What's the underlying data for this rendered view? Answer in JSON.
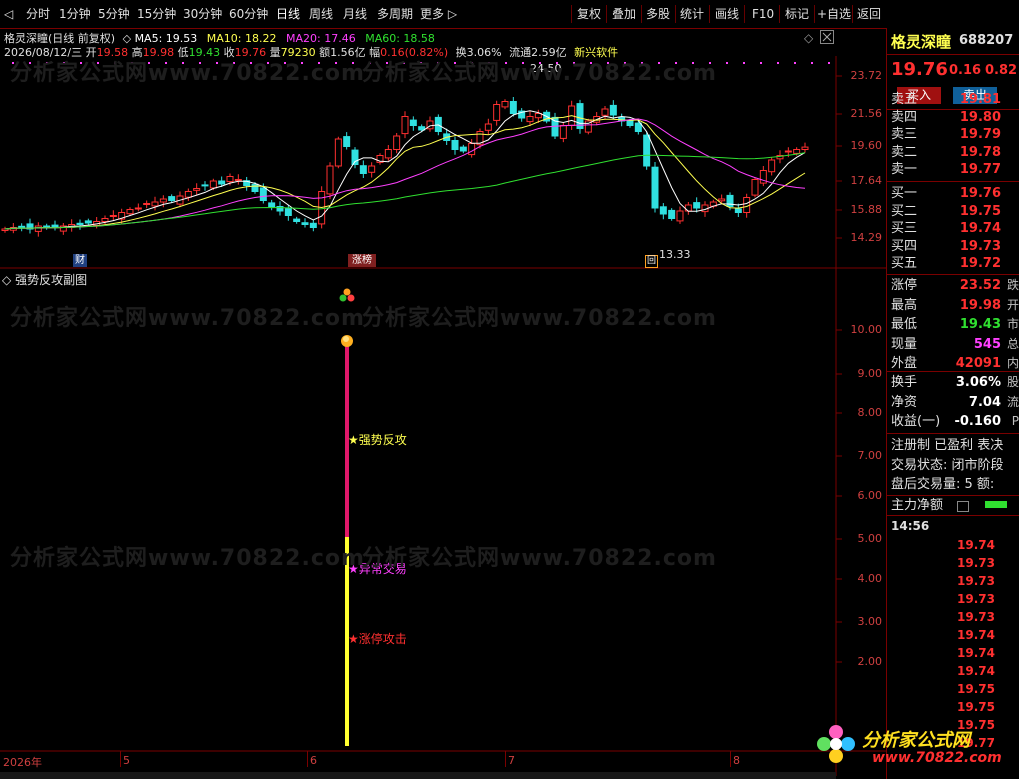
{
  "toolbar": {
    "left_arrow": "◁",
    "periods": [
      "分时",
      "1分钟",
      "5分钟",
      "15分钟",
      "30分钟",
      "60分钟",
      "日线",
      "周线",
      "月线",
      "多周期",
      "更多 ▷"
    ],
    "active_period": "日线",
    "actions": [
      "复权",
      "叠加",
      "多股",
      "统计",
      "画线",
      "F10",
      "标记",
      "+自选",
      "返回"
    ]
  },
  "stock": {
    "name": "格灵深瞳",
    "chart_title": "格灵深瞳(日线 前复权)",
    "code": "688207",
    "price": "19.76",
    "change": "0.16",
    "change_pct": "0.82"
  },
  "ma_legend": {
    "ma5": "MA5: 19.53",
    "ma10": "MA10: 18.22",
    "ma20": "MA20: 17.46",
    "ma60": "MA60: 18.58"
  },
  "day_info": {
    "date": "2026/08/12/三",
    "open_label": "开",
    "open": "19.58",
    "high_label": "高",
    "high": "19.98",
    "low_label": "低",
    "low": "19.43",
    "close_label": "收",
    "close": "19.76",
    "vol_label": "量",
    "vol": "79230",
    "amt_label": "额",
    "amt": "1.56亿",
    "amp_label": "幅",
    "amp": "0.16(0.82%)",
    "turnover": "换3.06%",
    "float": "流通2.59亿",
    "sector": "新兴软件"
  },
  "main_axis": [
    "23.72",
    "21.56",
    "19.60",
    "17.64",
    "15.88",
    "14.29"
  ],
  "annotations": {
    "high_mark": "24.50",
    "low_mark": "13.33",
    "cai_tag": "财",
    "zhangbang_tag": "涨榜",
    "box_tag": "回"
  },
  "sub_chart": {
    "title": "强势反攻副图",
    "axis": [
      "10.00",
      "9.00",
      "8.00",
      "7.00",
      "6.00",
      "5.00",
      "4.00",
      "3.00",
      "2.00"
    ],
    "labels": {
      "strong": "★强势反攻",
      "abnormal": "★异常交易",
      "limit": "★涨停攻击"
    }
  },
  "x_axis": {
    "year": "2026年",
    "months": [
      "5",
      "6",
      "7",
      "8"
    ]
  },
  "watermark_text": "分析家公式网www.70822.com",
  "right_panel": {
    "buy_btn": "买入",
    "sell_btn": "卖出",
    "asks": [
      {
        "label": "卖五",
        "price": "19.81"
      },
      {
        "label": "卖四",
        "price": "19.80"
      },
      {
        "label": "卖三",
        "price": "19.79"
      },
      {
        "label": "卖二",
        "price": "19.78"
      },
      {
        "label": "卖一",
        "price": "19.77"
      }
    ],
    "bids": [
      {
        "label": "买一",
        "price": "19.76"
      },
      {
        "label": "买二",
        "price": "19.75"
      },
      {
        "label": "买三",
        "price": "19.74"
      },
      {
        "label": "买四",
        "price": "19.73"
      },
      {
        "label": "买五",
        "price": "19.72"
      }
    ],
    "stats": [
      {
        "label": "涨停",
        "value": "23.52",
        "extra": "跌",
        "color": "#ff3030"
      },
      {
        "label": "最高",
        "value": "19.98",
        "extra": "开",
        "color": "#ff3030"
      },
      {
        "label": "最低",
        "value": "19.43",
        "extra": "市",
        "color": "#30e030"
      },
      {
        "label": "现量",
        "value": "545",
        "extra": "总",
        "color": "#ff40ff"
      },
      {
        "label": "外盘",
        "value": "42091",
        "extra": "内",
        "color": "#ff3030"
      }
    ],
    "stats2": [
      {
        "label": "换手",
        "value": "3.06%",
        "extra": "股",
        "color": "#ffffff"
      },
      {
        "label": "净资",
        "value": "7.04",
        "extra": "流",
        "color": "#ffffff"
      },
      {
        "label": "收益(一)",
        "value": "-0.160",
        "extra": "P",
        "color": "#ffffff"
      }
    ],
    "reg_line": "注册制 已盈利 表决",
    "trade_status": "交易状态: 闭市阶段",
    "after_hours": "盘后交易量: 5  额:",
    "main_flow": "主力净额",
    "tick_time": "14:56",
    "ticks": [
      "19.74",
      "19.73",
      "19.73",
      "19.73",
      "19.73",
      "19.74",
      "19.74",
      "19.74",
      "19.75",
      "19.75",
      "19.75",
      "19.77"
    ]
  },
  "logo": {
    "title": "分析家公式网",
    "url": "www.70822.com"
  }
}
